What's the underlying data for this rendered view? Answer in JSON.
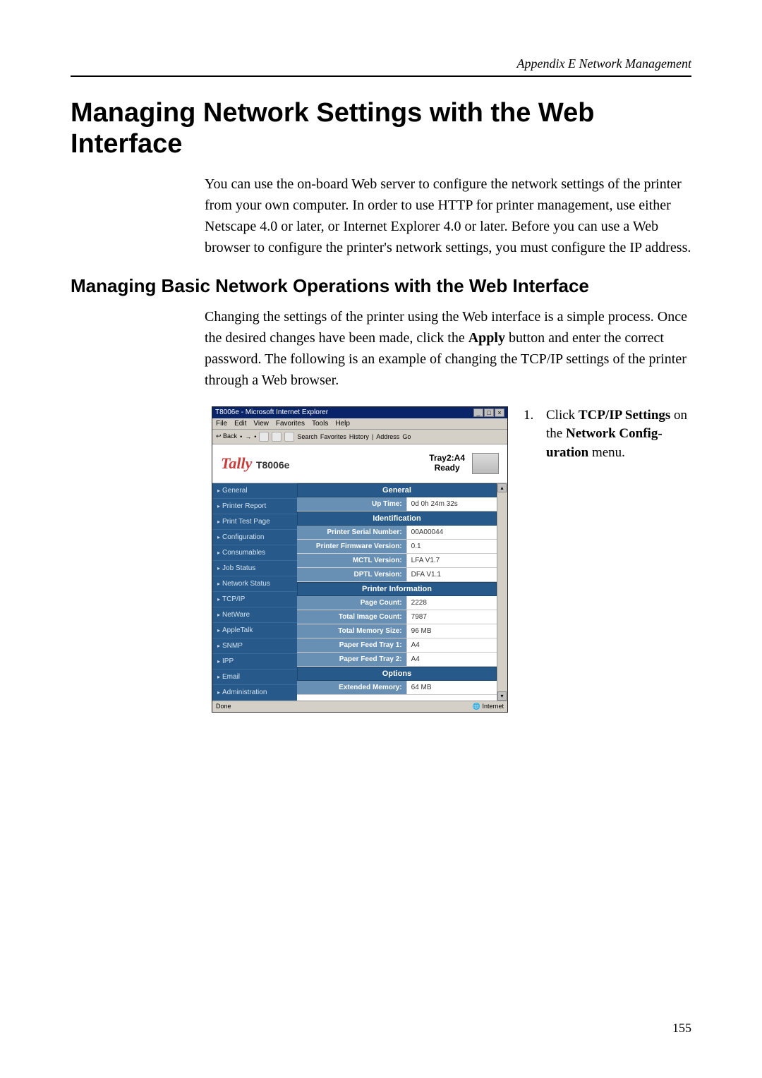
{
  "header": {
    "breadcrumb": "Appendix E Network Management"
  },
  "title": "Managing Network Settings with the Web Interface",
  "intro": "You can use the on-board Web server to configure the network settings of the printer from your own computer. In order to use HTTP for printer management, use either Netscape 4.0 or later, or Internet Explorer 4.0 or later. Before you can use a Web browser to configure the printer's network settings, you must configure the IP address.",
  "subheading": "Managing Basic Network Operations with the Web Interface",
  "subtext_prefix": "Changing the settings of the printer using the Web interface is a simple process. Once the desired changes have been made, click the ",
  "subtext_bold": "Apply",
  "subtext_suffix": " button and enter the correct password. The following is an example of changing the TCP/IP settings of the printer through a Web browser.",
  "step": {
    "num": "1.",
    "part1": "Click ",
    "bold1": "TCP/IP Settings",
    "part2": " on the ",
    "bold2": "Network Config­uration",
    "part3": " menu."
  },
  "browser": {
    "title": "T8006e - Microsoft Internet Explorer",
    "menu": [
      "File",
      "Edit",
      "View",
      "Favorites",
      "Tools",
      "Help"
    ],
    "toolbar_back": "Back",
    "toolbar_search": "Search",
    "toolbar_favorites": "Favorites",
    "toolbar_history": "History",
    "toolbar_address": "Address",
    "toolbar_go": "Go",
    "brand_name": "Tally",
    "brand_model": "T8006e",
    "tray_line1": "Tray2:A4",
    "tray_line2": "Ready",
    "sidebar": [
      "General",
      "Printer Report",
      "Print Test Page",
      "Configuration",
      "Consumables",
      "Job Status",
      "Network Status",
      "TCP/IP",
      "NetWare",
      "AppleTalk",
      "SNMP",
      "IPP",
      "Email",
      "Administration"
    ],
    "sections": {
      "general": "General",
      "identification": "Identification",
      "printer_information": "Printer Information",
      "options": "Options"
    },
    "rows": {
      "up_time": {
        "label": "Up Time:",
        "value": "0d 0h 24m 32s"
      },
      "serial": {
        "label": "Printer Serial Number:",
        "value": "00A00044"
      },
      "firmware": {
        "label": "Printer Firmware Version:",
        "value": "0.1"
      },
      "mctl": {
        "label": "MCTL Version:",
        "value": "LFA V1.7"
      },
      "dptl": {
        "label": "DPTL Version:",
        "value": "DFA V1.1"
      },
      "page_count": {
        "label": "Page Count:",
        "value": "2228"
      },
      "image_count": {
        "label": "Total Image Count:",
        "value": "7987"
      },
      "memory_size": {
        "label": "Total Memory Size:",
        "value": "96 MB"
      },
      "tray1": {
        "label": "Paper Feed Tray 1:",
        "value": "A4"
      },
      "tray2": {
        "label": "Paper Feed Tray 2:",
        "value": "A4"
      },
      "ext_memory": {
        "label": "Extended Memory:",
        "value": "64 MB"
      }
    },
    "status_done": "Done",
    "status_zone": "Internet"
  },
  "page_number": "155"
}
